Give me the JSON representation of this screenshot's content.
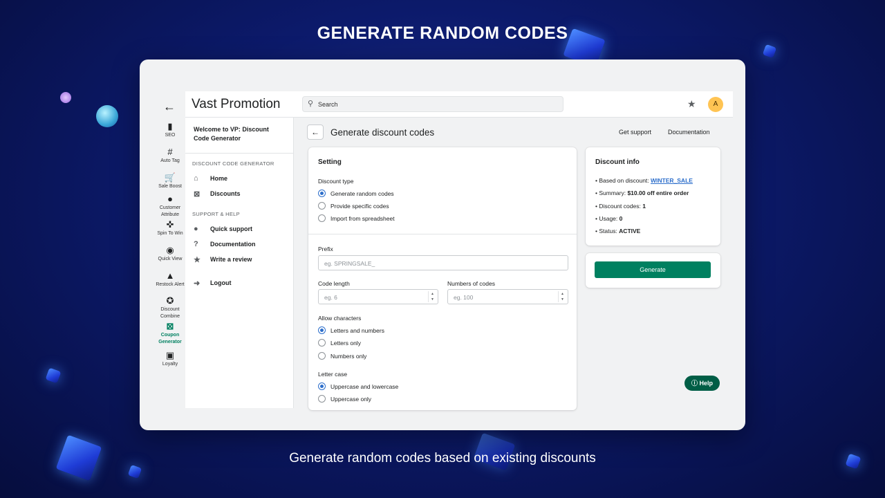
{
  "headline": "GENERATE RANDOM CODES",
  "caption": "Generate random codes based on existing discounts",
  "app": {
    "brand": "Vast Promotion",
    "search_placeholder": "Search",
    "avatar_initial": "A"
  },
  "rail": {
    "items": [
      {
        "label": "SEO",
        "icon": "bar-chart-icon",
        "glyph": "▮"
      },
      {
        "label": "Auto Tag",
        "icon": "hash-icon",
        "glyph": "#"
      },
      {
        "label": "Sale Boost",
        "icon": "cart-icon",
        "glyph": "🛒"
      },
      {
        "label": "Customer Attribute",
        "icon": "person-icon",
        "glyph": "●"
      },
      {
        "label": "Spin To Win",
        "icon": "gamepad-icon",
        "glyph": "✜"
      },
      {
        "label": "Quick View",
        "icon": "eye-icon",
        "glyph": "◉"
      },
      {
        "label": "Restock Alert",
        "icon": "bell-icon",
        "glyph": "▲"
      },
      {
        "label": "Discount Combine",
        "icon": "discount-icon",
        "glyph": "✪"
      },
      {
        "label": "Coupon Generator",
        "icon": "coupon-icon",
        "glyph": "⊠"
      },
      {
        "label": "Loyalty",
        "icon": "gift-icon",
        "glyph": "▣"
      }
    ]
  },
  "nav": {
    "welcome": "Welcome to VP: Discount Code Generator",
    "section1": "DISCOUNT CODE GENERATOR",
    "home": "Home",
    "discounts": "Discounts",
    "section2": "SUPPORT & HELP",
    "quick_support": "Quick support",
    "documentation": "Documentation",
    "write_review": "Write a review",
    "logout": "Logout"
  },
  "page": {
    "title": "Generate discount codes",
    "get_support": "Get support",
    "documentation": "Documentation"
  },
  "settings": {
    "title": "Setting",
    "discount_type_label": "Discount type",
    "discount_type_options": [
      "Generate random codes",
      "Provide specific codes",
      "Import from spreadsheet"
    ],
    "discount_type_selected": "Generate random codes",
    "prefix_label": "Prefix",
    "prefix_placeholder": "eg. SPRINGSALE_",
    "code_length_label": "Code length",
    "code_length_placeholder": "eg. 6",
    "numbers_label": "Numbers of codes",
    "numbers_placeholder": "eg. 100",
    "allow_label": "Allow characters",
    "allow_options": [
      "Letters and numbers",
      "Letters only",
      "Numbers only"
    ],
    "allow_selected": "Letters and numbers",
    "case_label": "Letter case",
    "case_options": [
      "Uppercase and lowercase",
      "Uppercase only"
    ],
    "case_selected": "Uppercase and lowercase"
  },
  "info": {
    "title": "Discount info",
    "based_label": "Based on discount: ",
    "based_value": "WINTER_SALE",
    "summary_label": "Summary: ",
    "summary_value": "$10.00 off entire order",
    "codes_label": "Discount codes: ",
    "codes_value": "1",
    "usage_label": "Usage: ",
    "usage_value": "0",
    "status_label": "Status: ",
    "status_value": "ACTIVE"
  },
  "generate_label": "Generate",
  "help_label": "Help",
  "colors": {
    "primary": "#008060",
    "link": "#2c6ecb",
    "help": "#005e46"
  }
}
